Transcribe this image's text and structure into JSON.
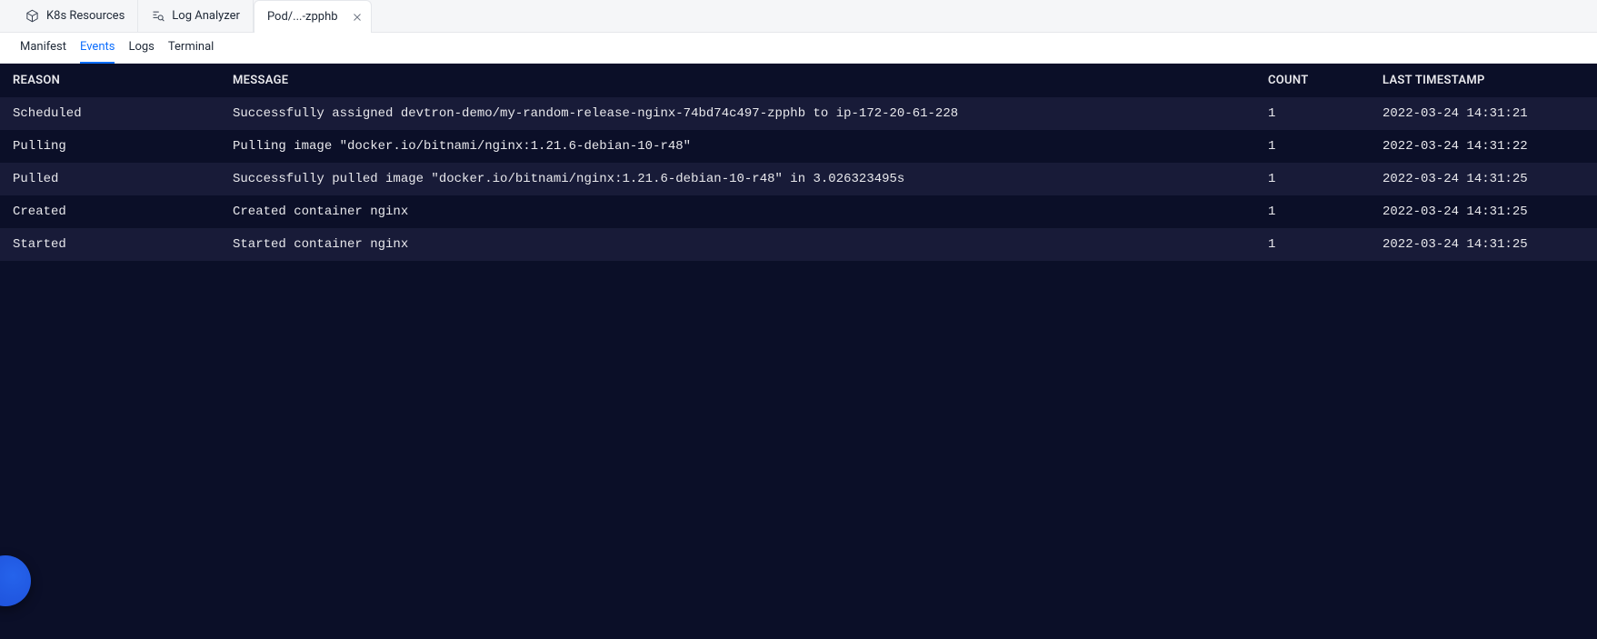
{
  "topTabs": {
    "items": [
      {
        "label": "K8s Resources",
        "active": false,
        "icon": "cube",
        "closable": false
      },
      {
        "label": "Log Analyzer",
        "active": false,
        "icon": "search-log",
        "closable": false
      },
      {
        "label": "Pod/...-zpphb",
        "active": true,
        "icon": null,
        "closable": true
      }
    ]
  },
  "subTabs": {
    "items": [
      {
        "label": "Manifest",
        "active": false
      },
      {
        "label": "Events",
        "active": true
      },
      {
        "label": "Logs",
        "active": false
      },
      {
        "label": "Terminal",
        "active": false
      }
    ]
  },
  "table": {
    "headers": {
      "reason": "REASON",
      "message": "MESSAGE",
      "count": "COUNT",
      "timestamp": "LAST TIMESTAMP"
    },
    "rows": [
      {
        "reason": "Scheduled",
        "message": "Successfully assigned devtron-demo/my-random-release-nginx-74bd74c497-zpphb to ip-172-20-61-228",
        "count": "1",
        "timestamp": "2022-03-24 14:31:21"
      },
      {
        "reason": "Pulling",
        "message": "Pulling image \"docker.io/bitnami/nginx:1.21.6-debian-10-r48\"",
        "count": "1",
        "timestamp": "2022-03-24 14:31:22"
      },
      {
        "reason": "Pulled",
        "message": "Successfully pulled image \"docker.io/bitnami/nginx:1.21.6-debian-10-r48\" in 3.026323495s",
        "count": "1",
        "timestamp": "2022-03-24 14:31:25"
      },
      {
        "reason": "Created",
        "message": "Created container nginx",
        "count": "1",
        "timestamp": "2022-03-24 14:31:25"
      },
      {
        "reason": "Started",
        "message": "Started container nginx",
        "count": "1",
        "timestamp": "2022-03-24 14:31:25"
      }
    ]
  }
}
